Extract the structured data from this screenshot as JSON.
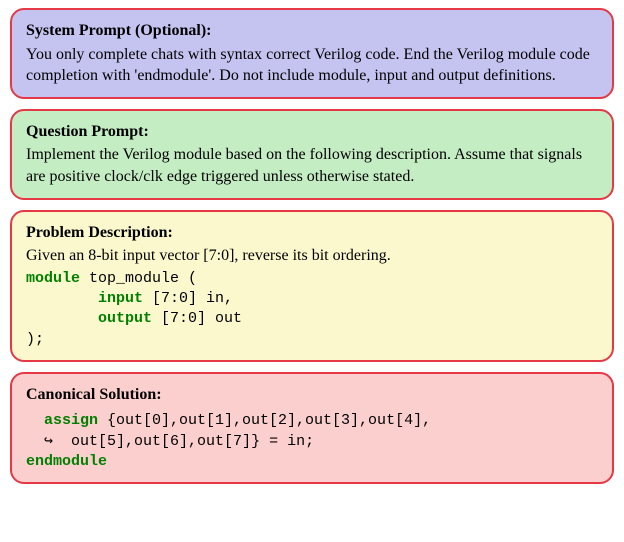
{
  "system": {
    "heading": "System Prompt (Optional):",
    "text": "You only complete chats with syntax correct Verilog code. End the Verilog module code completion with 'endmodule'. Do not include module, input and output definitions."
  },
  "question": {
    "heading": "Question Prompt:",
    "text": "Implement the Verilog module based on the following description. Assume that signals are positive clock/clk edge triggered unless otherwise stated."
  },
  "problem": {
    "heading": "Problem Description:",
    "text": "Given an 8-bit input vector [7:0], reverse its bit ordering.",
    "code": {
      "kw_module": "module",
      "module_rest": " top_module (",
      "kw_input": "input",
      "input_rest": " [7:0] in,",
      "kw_output": "output",
      "output_rest": " [7:0] out",
      "close": ");"
    }
  },
  "solution": {
    "heading": "Canonical Solution:",
    "code": {
      "kw_assign": "assign",
      "assign_rest": " {out[0],out[1],out[2],out[3],out[4],",
      "cont_arrow": "↪",
      "cont_rest": "  out[5],out[6],out[7]} = in;",
      "kw_endmodule": "endmodule"
    }
  }
}
